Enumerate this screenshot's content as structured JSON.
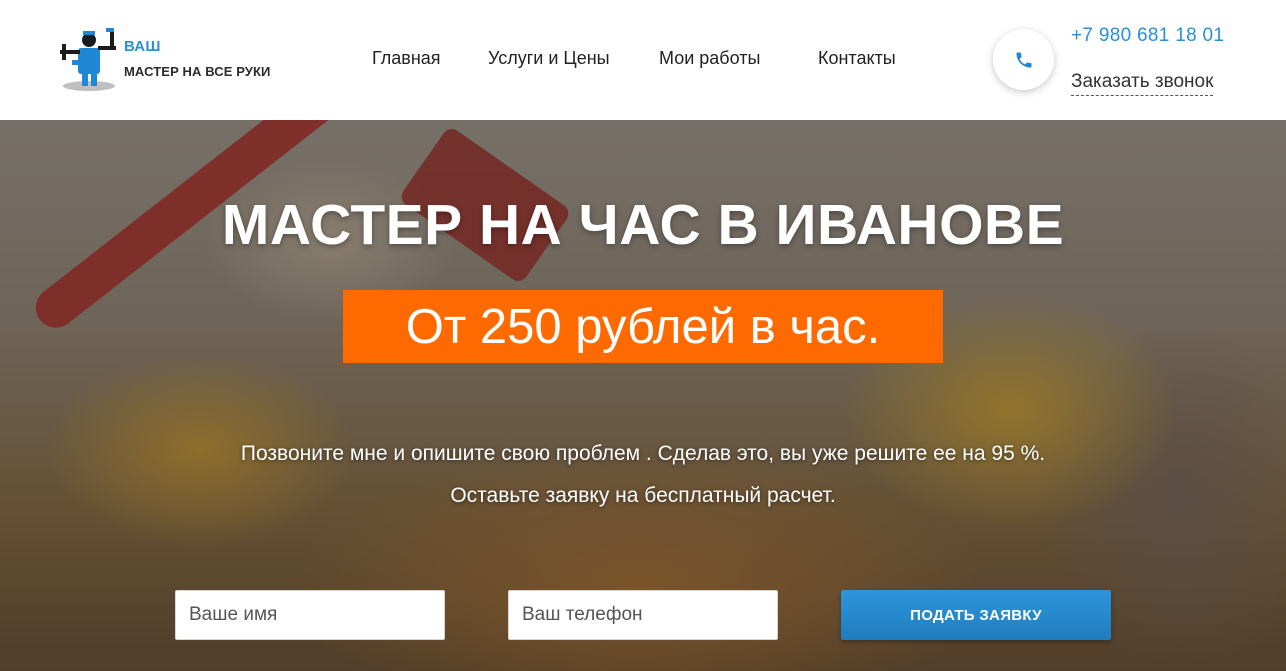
{
  "header": {
    "logo": {
      "line1": "ВАШ",
      "line2": "МАСТЕР НА ВСЕ РУКИ"
    },
    "nav": [
      {
        "label": "Главная"
      },
      {
        "label": "Услуги и Цены"
      },
      {
        "label": "Мои работы"
      },
      {
        "label": "Контакты"
      }
    ],
    "phone": "+7 980 681 18 01",
    "callback": "Заказать звонок",
    "icons": {
      "call": "phone-icon",
      "logo": "handyman-logo-icon"
    }
  },
  "hero": {
    "title": "МАСТЕР НА ЧАС В ИВАНОВЕ",
    "price": "От 250 рублей в час.",
    "subtitle1": "Позвоните мне и опишите свою проблем . Сделав это, вы уже решите ее на 95 %.",
    "subtitle2": "Оставьте заявку на бесплатный расчет."
  },
  "form": {
    "name_placeholder": "Ваше имя",
    "phone_placeholder": "Ваш телефон",
    "submit": "ПОДАТЬ ЗАЯВКУ"
  },
  "colors": {
    "accent_blue": "#2a8fd6",
    "price_orange": "#ff6a00",
    "button_blue": "#1f7dbe"
  }
}
